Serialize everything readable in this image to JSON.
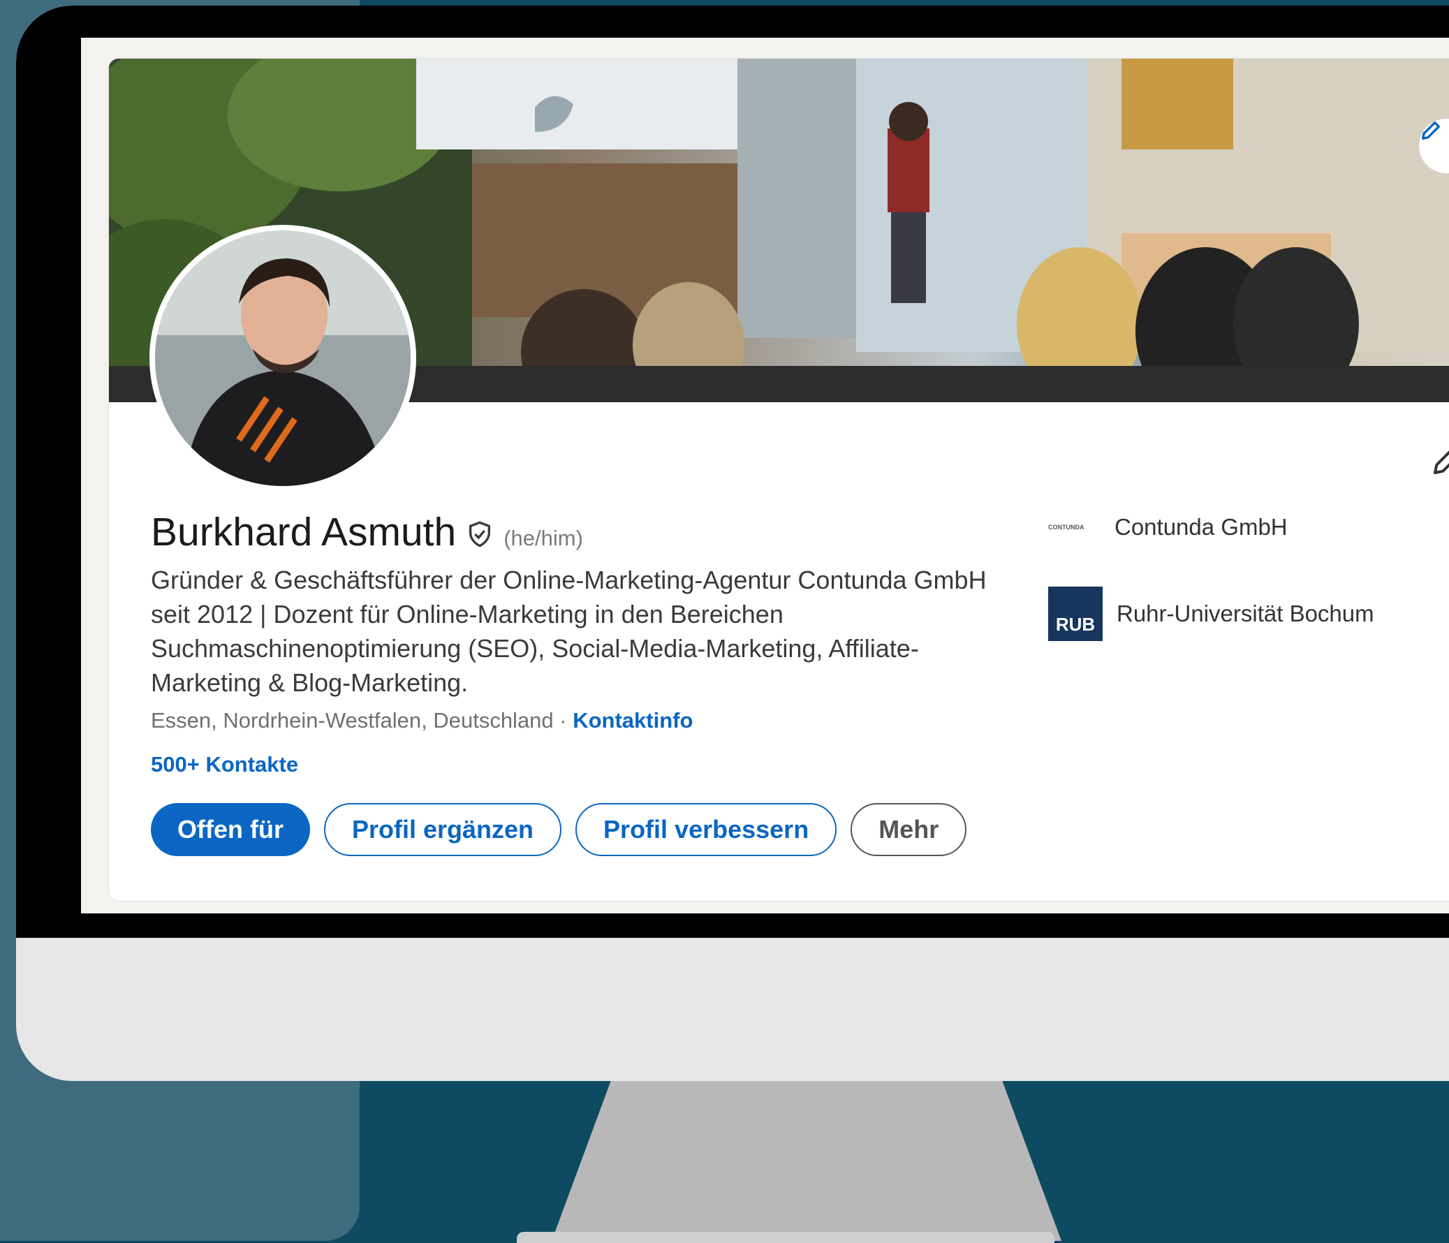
{
  "profile": {
    "name": "Burkhard Asmuth",
    "pronouns": "(he/him)",
    "headline": "Gründer & Geschäftsführer der Online-Marketing-Agentur Contunda GmbH seit 2012 | Dozent für Online-Marketing in den Bereichen Suchmaschinenoptimierung (SEO), Social-Media-Marketing, Affiliate-Marketing & Blog-Marketing.",
    "location": "Essen, Nordrhein-Westfalen, Deutschland · ",
    "contact_info_link": "Kontaktinfo",
    "connections": "500+ Kontakte"
  },
  "actions": {
    "open_to": "Offen für",
    "add_profile_section": "Profil ergänzen",
    "enhance_profile": "Profil verbessern",
    "more": "Mehr"
  },
  "organizations": [
    {
      "name": "Contunda GmbH",
      "logo_text": "CONTUNDA"
    },
    {
      "name": "Ruhr-Universität Bochum",
      "logo_text": "RUB"
    }
  ],
  "icons": {
    "verified": "shield-check-icon",
    "edit_cover": "pencil-icon",
    "edit_intro": "pencil-icon"
  },
  "colors": {
    "accent": "#0a66c2",
    "page_bg": "#0e4a61",
    "bezel": "#000000"
  }
}
